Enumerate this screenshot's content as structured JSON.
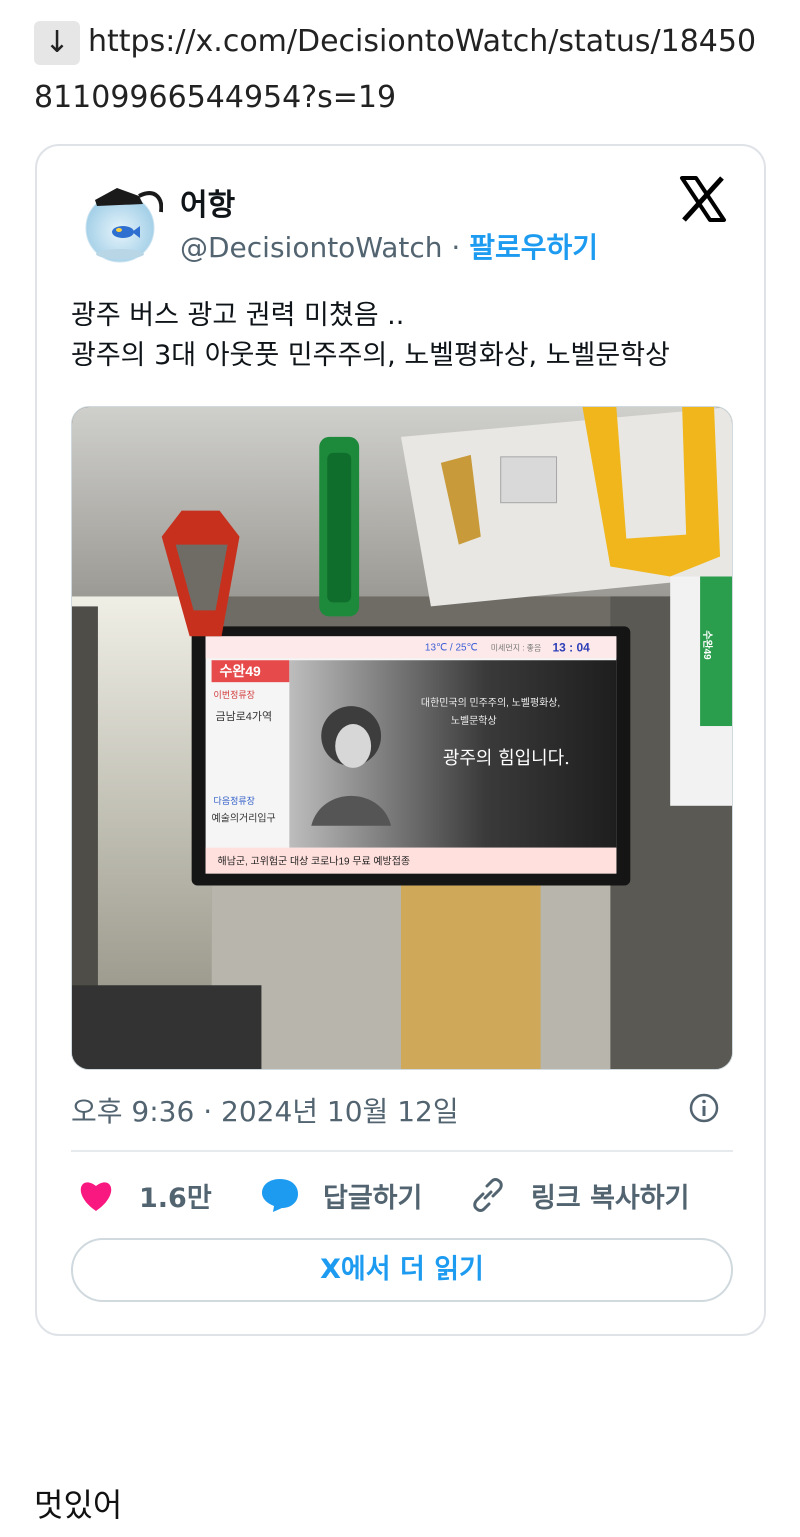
{
  "link": {
    "arrow": "↓",
    "url": "https://x.com/DecisiontoWatch/status/1845081109966544954?s=19"
  },
  "tweet": {
    "author_name": "어항",
    "handle": "@DecisiontoWatch",
    "separator": "·",
    "follow_label": "팔로우하기",
    "text_line1": "광주 버스 광고 권력 미쳤음 ..",
    "text_line2": "광주의 3대 아웃풋 민주주의, 노벨평화상, 노벨문학상",
    "timestamp": "오후 9:36 · 2024년 10월 12일",
    "likes": "1.6만",
    "reply_label": "답글하기",
    "copy_link_label": "링크 복사하기",
    "read_more_label": "X에서 더 읽기"
  },
  "photo": {
    "route": "수완49",
    "current_stop_label": "이번정류장",
    "current_stop": "금남로4가역",
    "next_stop_label": "다음정류장",
    "next_stop": "예술의거리입구",
    "weather": "13℃ / 25℃",
    "dust": "미세먼지 : 좋음",
    "time": "13 : 04",
    "ad_line1": "대한민국의 민주주의, 노벨평화상,",
    "ad_line2": "노벨문학상",
    "ad_slogan": "광주의 힘입니다.",
    "ticker": "해남군, 고위험군 대상 코로나19 무료 예방접종",
    "side_sign": "수완49"
  },
  "comment": "멋있어",
  "colors": {
    "accent": "#1d9bf0",
    "like": "#f91880",
    "muted": "#536471",
    "border": "#cfd9de"
  },
  "icons": [
    "download-arrow-icon",
    "x-logo-icon",
    "heart-icon",
    "reply-bubble-icon",
    "link-icon",
    "info-icon"
  ]
}
